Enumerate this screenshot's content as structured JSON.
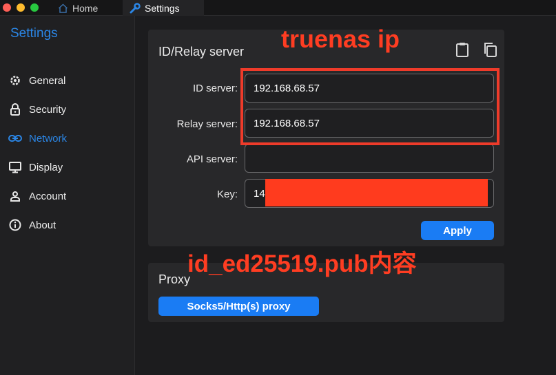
{
  "window": {
    "tabs": [
      {
        "label": "Home",
        "icon": "home-icon"
      },
      {
        "label": "Settings",
        "icon": "wrench-icon"
      }
    ]
  },
  "sidebar": {
    "title": "Settings",
    "items": [
      {
        "label": "General",
        "icon": "gear-icon"
      },
      {
        "label": "Security",
        "icon": "lock-icon"
      },
      {
        "label": "Network",
        "icon": "link-icon",
        "active": true
      },
      {
        "label": "Display",
        "icon": "monitor-icon"
      },
      {
        "label": "Account",
        "icon": "person-icon"
      },
      {
        "label": "About",
        "icon": "info-icon"
      }
    ]
  },
  "server_card": {
    "title": "ID/Relay server",
    "icons": [
      "clipboard-icon",
      "copy-icon"
    ],
    "fields": {
      "id_server": {
        "label": "ID server:",
        "value": "192.168.68.57"
      },
      "relay_server": {
        "label": "Relay server:",
        "value": "192.168.68.57"
      },
      "api_server": {
        "label": "API server:",
        "value": ""
      },
      "key": {
        "label": "Key:",
        "value": "14"
      }
    },
    "apply_label": "Apply"
  },
  "proxy_card": {
    "title": "Proxy",
    "button_label": "Socks5/Http(s) proxy"
  },
  "annotations": {
    "top_note": "truenas ip",
    "bottom_note": "id_ed25519.pub内容"
  },
  "colors": {
    "accent": "#2b86e6",
    "button": "#1a7cf4",
    "annotation_red": "#ff3d22"
  }
}
